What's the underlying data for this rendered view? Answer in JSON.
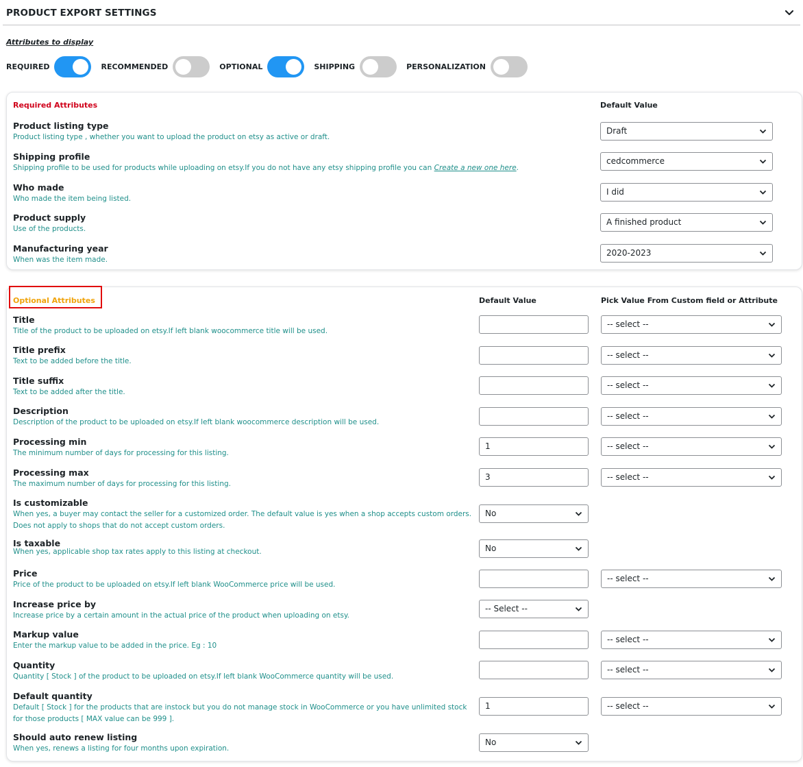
{
  "header": {
    "title": "PRODUCT EXPORT SETTINGS"
  },
  "attributes_display": {
    "label": "Attributes to display",
    "toggles": [
      {
        "label": "REQUIRED",
        "on": true
      },
      {
        "label": "RECOMMENDED",
        "on": false
      },
      {
        "label": "OPTIONAL",
        "on": true
      },
      {
        "label": "SHIPPING",
        "on": false
      },
      {
        "label": "PERSONALIZATION",
        "on": false
      }
    ]
  },
  "required": {
    "title": "Required Attributes",
    "default_value_header": "Default Value",
    "rows": [
      {
        "name": "Product listing type",
        "desc": "Product listing type , whether you want to upload the product on etsy as active or draft.",
        "value": "Draft"
      },
      {
        "name": "Shipping profile",
        "desc": "Shipping profile to be used for products while uploading on etsy.If you do not have any etsy shipping profile you can ",
        "link": "Create a new one here",
        "desc_after": ".",
        "value": "cedcommerce"
      },
      {
        "name": "Who made",
        "desc": "Who made the item being listed.",
        "value": "I did"
      },
      {
        "name": "Product supply",
        "desc": "Use of the products.",
        "value": "A finished product"
      },
      {
        "name": "Manufacturing year",
        "desc": "When was the item made.",
        "value": "2020-2023"
      }
    ]
  },
  "optional": {
    "title": "Optional Attributes",
    "default_value_header": "Default Value",
    "pick_header": "Pick Value From Custom field or Attribute",
    "rows": [
      {
        "name": "Title",
        "desc": "Title of the product to be uploaded on etsy.If left blank woocommerce title will be used.",
        "value": "",
        "pick": "-- select --"
      },
      {
        "name": "Title prefix",
        "desc": "Text to be added before the title.",
        "value": "",
        "pick": "-- select --"
      },
      {
        "name": "Title suffix",
        "desc": "Text to be added after the title.",
        "value": "",
        "pick": "-- select --"
      },
      {
        "name": "Description",
        "desc": "Description of the product to be uploaded on etsy.If left blank woocommerce description will be used.",
        "value": "",
        "pick": "-- select --"
      },
      {
        "name": "Processing min",
        "desc": "The minimum number of days for processing for this listing.",
        "value": "1",
        "pick": "-- select --"
      },
      {
        "name": "Processing max",
        "desc": "The maximum number of days for processing for this listing.",
        "value": "3",
        "pick": "-- select --"
      },
      {
        "name": "Is customizable",
        "desc": "When yes, a buyer may contact the seller for a customized order. The default value is yes when a shop accepts custom orders. Does not apply to shops that do not accept custom orders.",
        "value": "No"
      },
      {
        "name": "Is taxable",
        "desc": "When yes, applicable shop tax rates apply to this listing at checkout.",
        "value": "No"
      },
      {
        "name": "Price",
        "desc": "Price of the product to be uploaded on etsy.If left blank WooCommerce price will be used.",
        "value": "",
        "pick": "-- select --"
      },
      {
        "name": "Increase price by",
        "desc": "Increase price by a certain amount in the actual price of the product when uploading on etsy.",
        "value": "-- Select --"
      },
      {
        "name": "Markup value",
        "desc": "Enter the markup value to be added in the price. Eg : 10",
        "value": "",
        "pick": "-- select --"
      },
      {
        "name": "Quantity",
        "desc": "Quantity [ Stock ] of the product to be uploaded on etsy.If left blank WooCommerce quantity will be used.",
        "value": "",
        "pick": "-- select --"
      },
      {
        "name": "Default quantity",
        "desc": "Default [ Stock ] for the products that are instock but you do not manage stock in WooCommerce or you have unlimited stock for those products [ MAX value can be 999 ].",
        "value": "1",
        "pick": "-- select --"
      },
      {
        "name": "Should auto renew listing",
        "desc": "When yes, renews a listing for four months upon expiration.",
        "value": "No"
      }
    ]
  },
  "colors": {
    "required_title": "#d0021b",
    "optional_title": "#f0a30a",
    "desc_text": "#1f8f8a",
    "toggle_on": "#2196f3",
    "toggle_off": "#cccccc",
    "highlight": "#e10c0c"
  }
}
